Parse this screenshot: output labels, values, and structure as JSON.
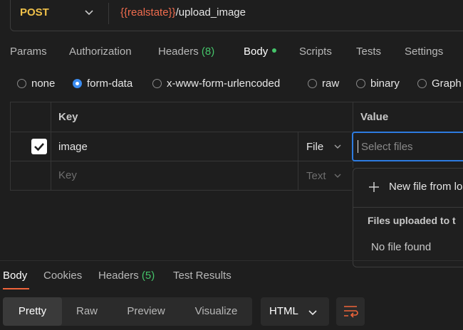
{
  "request": {
    "method": "POST",
    "url_var": "{{realstate}}",
    "url_path": "/upload_image"
  },
  "tabs": {
    "params": "Params",
    "authorization": "Authorization",
    "headers_label": "Headers",
    "headers_count": "(8)",
    "body": "Body",
    "scripts": "Scripts",
    "tests": "Tests",
    "settings": "Settings"
  },
  "body_types": {
    "none": "none",
    "form_data": "form-data",
    "urlencoded": "x-www-form-urlencoded",
    "raw": "raw",
    "binary": "binary",
    "graphql": "Graph"
  },
  "table": {
    "key_header": "Key",
    "value_header": "Value",
    "row1_key": "image",
    "row1_type": "File",
    "row1_placeholder": "Select files",
    "row2_key_placeholder": "Key",
    "row2_type": "Text"
  },
  "dropdown": {
    "new_file": "New file from lo",
    "uploaded_heading": "Files uploaded to t",
    "empty": "No file found"
  },
  "response_tabs": {
    "body": "Body",
    "cookies": "Cookies",
    "headers_label": "Headers",
    "headers_count": "(5)",
    "test_results": "Test Results"
  },
  "view_modes": {
    "pretty": "Pretty",
    "raw": "Raw",
    "preview": "Preview",
    "visualize": "Visualize"
  },
  "format_select": "HTML",
  "colors": {
    "accent_blue": "#2d7be0",
    "method_yellow": "#f0c14a",
    "variable_orange": "#f06c4e",
    "count_green": "#45c46a",
    "tab_underline": "#f0643a"
  }
}
